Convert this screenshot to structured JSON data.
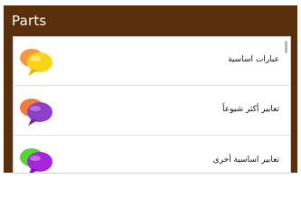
{
  "header": {
    "title": "Parts"
  },
  "list": {
    "items": [
      {
        "label": "عبارات اساسية",
        "icon": "chat-bubbles-orange-yellow-icon",
        "back_color": "#f59a3a",
        "front_color": "#f9d51a"
      },
      {
        "label": "تعابير أكثر شيوعاً",
        "icon": "chat-bubbles-orange-purple-icon",
        "back_color": "#f27a3a",
        "front_color": "#8e3fc8"
      },
      {
        "label": "تعابير اساسية أخرى",
        "icon": "chat-bubbles-green-purple-icon",
        "back_color": "#58d23a",
        "front_color": "#a526d8"
      }
    ]
  },
  "colors": {
    "header_background": "#5a2f0c",
    "title_text": "#ffffff",
    "row_background": "#ffffff",
    "label_text": "#111111"
  }
}
